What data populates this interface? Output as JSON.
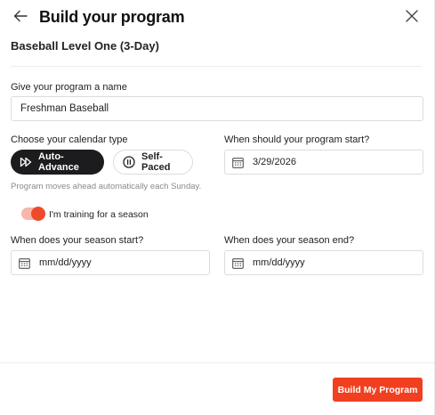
{
  "header": {
    "title": "Build your program",
    "back_icon": "arrow-left-icon",
    "close_icon": "close-icon"
  },
  "program": {
    "subtitle": "Baseball Level One (3-Day)"
  },
  "name_field": {
    "label": "Give your program a name",
    "value": "Freshman Baseball"
  },
  "calendar_type": {
    "label": "Choose your calendar type",
    "options": [
      {
        "label": "Auto-Advance",
        "icon": "fast-forward-icon",
        "selected": true
      },
      {
        "label": "Self-Paced",
        "icon": "pause-circle-icon",
        "selected": false
      }
    ],
    "hint": "Program moves ahead automatically each Sunday."
  },
  "start_date": {
    "label": "When should your program start?",
    "value": "3/29/2026",
    "icon": "calendar-icon"
  },
  "season_toggle": {
    "label": "I'm training for a season",
    "on": true
  },
  "season_start": {
    "label": "When does your season start?",
    "placeholder": "mm/dd/yyyy"
  },
  "season_end": {
    "label": "When does your season end?",
    "placeholder": "mm/dd/yyyy"
  },
  "footer": {
    "submit_label": "Build My Program"
  },
  "colors": {
    "accent": "#f0401f",
    "dark_button": "#1c1c1e",
    "toggle_track": "#f7b7aa"
  }
}
